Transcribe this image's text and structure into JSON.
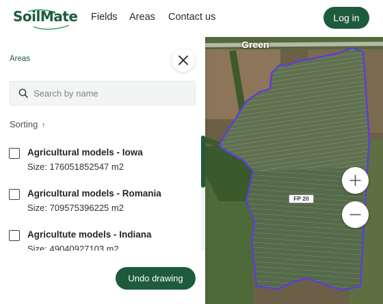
{
  "header": {
    "logo": "SoilMate",
    "nav": [
      "Fields",
      "Areas",
      "Contact us"
    ],
    "login_label": "Log in"
  },
  "panel": {
    "title": "Areas",
    "search_placeholder": "Search by name",
    "sorting_label": "Sorting",
    "sorting_arrow": "↑",
    "items": [
      {
        "name": "Agricultural models - Iowa",
        "size": "Size: 176051852547 m2"
      },
      {
        "name": "Agricultural models - Romania",
        "size": "Size: 709575396225 m2"
      },
      {
        "name": "Agricultute models - Indiana",
        "size": "Size: 49040927103 m2"
      }
    ],
    "undo_label": "Undo drawing"
  },
  "map": {
    "road_label": "Green",
    "path_label": "FP 20",
    "zoom_in_icon": "plus-icon",
    "zoom_out_icon": "minus-icon"
  },
  "colors": {
    "brand": "#1d5b3c",
    "polygon": "#5b3fd6"
  }
}
